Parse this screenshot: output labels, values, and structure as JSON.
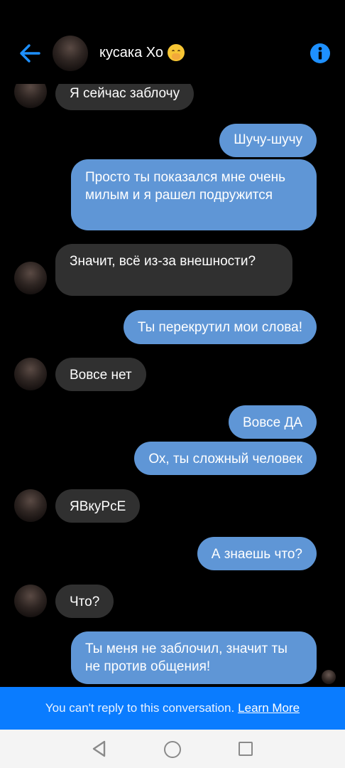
{
  "header": {
    "title": "кусака Хо",
    "back_icon": "arrow-left-icon",
    "info_icon": "info-icon",
    "accent_color": "#1e90ff"
  },
  "messages": [
    {
      "from": "them",
      "text": "Я сейчас заблочу"
    },
    {
      "from": "me",
      "text": "Шучу-шучу"
    },
    {
      "from": "me",
      "text": "Просто ты показался мне очень милым и я рашел подружится"
    },
    {
      "from": "them",
      "text": "Значит, всё из-за внешности?"
    },
    {
      "from": "me",
      "text": "Ты перекрутил мои слова!"
    },
    {
      "from": "them",
      "text": "Вовсе нет"
    },
    {
      "from": "me",
      "text": "Вовсе ДА"
    },
    {
      "from": "me",
      "text": "Ох, ты сложный человек"
    },
    {
      "from": "them",
      "text": "ЯВкуРсЕ"
    },
    {
      "from": "me",
      "text": "А знаешь что?"
    },
    {
      "from": "them",
      "text": "Что?"
    },
    {
      "from": "me",
      "text": "Ты меня не заблочил, значит ты не против общения!"
    }
  ],
  "banner": {
    "text": "You can't reply to this conversation.",
    "link": "Learn More",
    "color": "#0a7cff"
  },
  "navbar": {
    "back_icon": "triangle-back-icon",
    "home_icon": "circle-home-icon",
    "recents_icon": "square-recents-icon"
  },
  "colors": {
    "incoming_bubble": "#303030",
    "outgoing_bubble": "#5f96d6",
    "background": "#000000"
  }
}
